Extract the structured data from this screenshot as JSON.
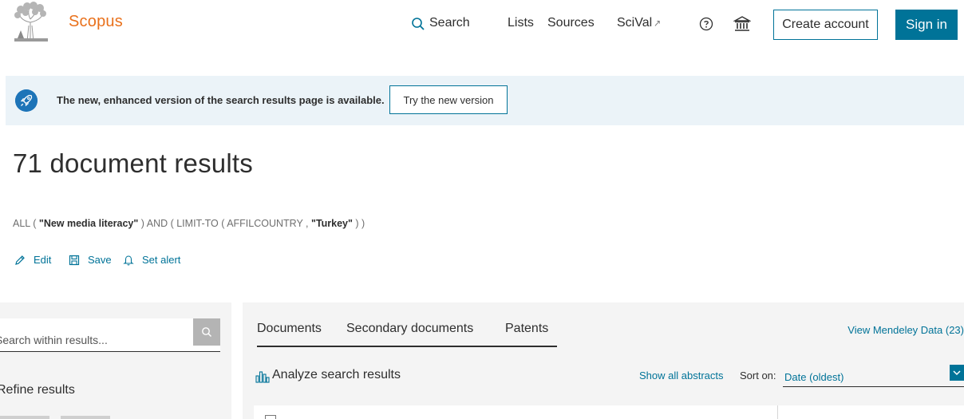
{
  "header": {
    "brand": "Scopus",
    "nav": {
      "search": "Search",
      "lists": "Lists",
      "sources": "Sources",
      "scival": "SciVal",
      "scival_ext": "↗"
    },
    "create_account": "Create account",
    "sign_in": "Sign in"
  },
  "banner": {
    "text": "The new, enhanced version of the search results page is available.",
    "button": "Try the new version"
  },
  "results": {
    "title": "71 document results",
    "query": {
      "p1": "ALL ( ",
      "term": "\"New media literacy\"",
      "p2": " )  AND  ( LIMIT-TO ( AFFILCOUNTRY ,  ",
      "country": "\"Turkey\"",
      "p3": " ) )"
    },
    "actions": {
      "edit": "Edit",
      "save": "Save",
      "set_alert": "Set alert"
    }
  },
  "left_panel": {
    "search_placeholder": "Search within results...",
    "refine": "Refine results"
  },
  "right_panel": {
    "tabs": [
      "Documents",
      "Secondary documents",
      "Patents"
    ],
    "mendeley": "View Mendeley Data (23)",
    "analyze": "Analyze search results",
    "show_abstracts": "Show all abstracts",
    "sort_label": "Sort on:",
    "sort_value": "Date (oldest)"
  },
  "colors": {
    "brand_orange": "#e9711c",
    "primary": "#007398",
    "banner_bg": "#ebf3f8",
    "panel_bg": "#f4f4f4"
  },
  "icons": {
    "logo": "elsevier-tree-logo",
    "search": "search-icon",
    "help": "help-circle-icon",
    "institution": "institution-icon",
    "rocket": "rocket-icon",
    "edit": "pencil-icon",
    "save": "floppy-icon",
    "alert": "bell-icon",
    "analyze": "bar-chart-icon",
    "caret": "chevron-down-icon"
  }
}
